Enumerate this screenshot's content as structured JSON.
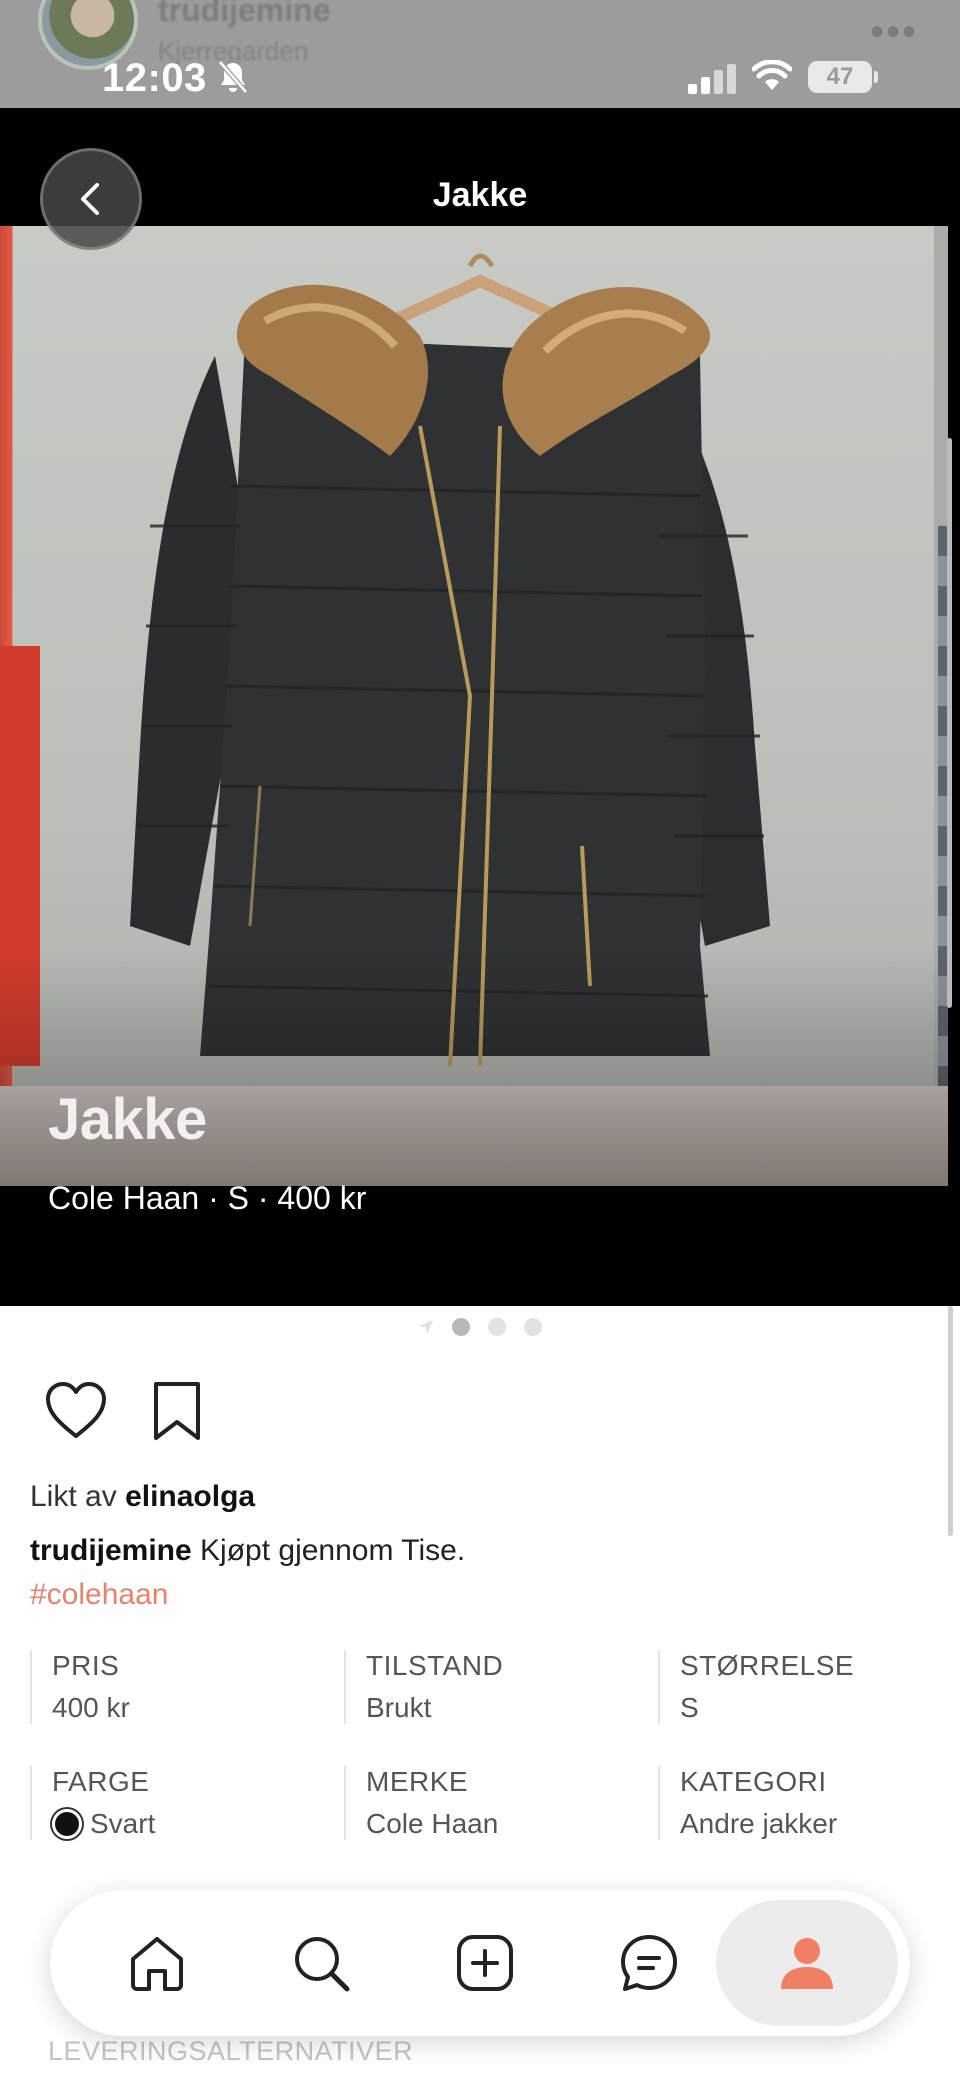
{
  "background_sheet": {
    "username": "trudijemine",
    "location": "Kjerregarden"
  },
  "status_bar": {
    "time": "12:03",
    "battery": "47"
  },
  "header": {
    "title": "Jakke"
  },
  "photo": {
    "overlay_title": "Jakke",
    "overlay_subtitle": "Cole Haan · S · 400 kr"
  },
  "carousel": {
    "pages": 3,
    "active_index": 0
  },
  "post": {
    "liked_prefix": "Likt av",
    "liked_by": "elinaolga",
    "author": "trudijemine",
    "caption": "Kjøpt gjennom Tise.",
    "hashtag": "#colehaan"
  },
  "specs": [
    {
      "label": "PRIS",
      "value": "400 kr"
    },
    {
      "label": "TILSTAND",
      "value": "Brukt"
    },
    {
      "label": "STØRRELSE",
      "value": "S"
    },
    {
      "label": "FARGE",
      "value": "Svart",
      "swatch": "#111111"
    },
    {
      "label": "MERKE",
      "value": "Cole Haan"
    },
    {
      "label": "KATEGORI",
      "value": "Andre jakker"
    }
  ],
  "delivery": {
    "label": "LEVERINGSALTERNATIVER"
  },
  "tabbar": {
    "items": [
      "home-icon",
      "search-icon",
      "add-icon",
      "chat-icon",
      "profile-icon"
    ],
    "active": "profile-icon",
    "accent": "#f07f66"
  },
  "colors": {
    "accent": "#e8826c",
    "sheet": "#000000"
  }
}
